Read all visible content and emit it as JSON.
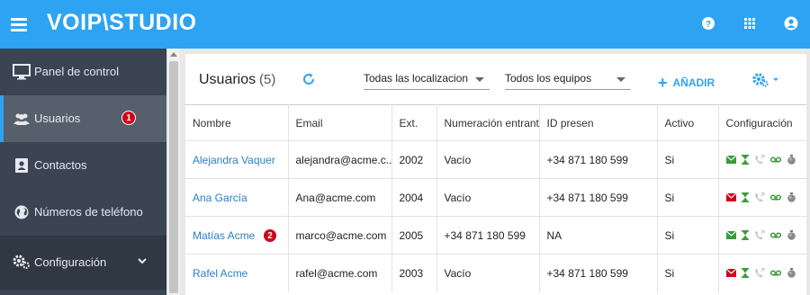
{
  "app": {
    "logo": "VOIP\\STUDIO"
  },
  "sidebar": {
    "items": [
      {
        "label": "Panel de control"
      },
      {
        "label": "Usuarios",
        "badge": "1"
      },
      {
        "label": "Contactos"
      },
      {
        "label": "Números de teléfono"
      },
      {
        "label": "Configuración"
      }
    ]
  },
  "header": {
    "title": "Usuarios",
    "count": "(5)",
    "location_select": "Todas las localizaciones",
    "team_select": "Todos los equipos",
    "add_label": "AÑADIR"
  },
  "table": {
    "columns": [
      "Nombre",
      "Email",
      "Ext.",
      "Numeración entrante",
      "ID presen",
      "Activo",
      "Configuración"
    ],
    "rows": [
      {
        "name": "Alejandra Vaquer",
        "email": "alejandra@acme.c...",
        "ext": "2002",
        "incoming": "Vacío",
        "caller_id": "+34 871 180 599",
        "active": "Si",
        "mail_status": "green"
      },
      {
        "name": "Ana García",
        "email": "Ana@acme.com",
        "ext": "2004",
        "incoming": "Vacío",
        "caller_id": "+34 871 180 599",
        "active": "Si",
        "mail_status": "red"
      },
      {
        "name": "Matías Acme",
        "badge": "2",
        "email": "marco@acme.com",
        "ext": "2005",
        "incoming": "+34 871 180 599",
        "caller_id": "NA",
        "active": "Si",
        "mail_status": "green"
      },
      {
        "name": "Rafel Acme",
        "email": "rafel@acme.com",
        "ext": "2003",
        "incoming": "Vacío",
        "caller_id": "+34 871 180 599",
        "active": "Si",
        "mail_status": "red"
      }
    ]
  },
  "colors": {
    "brand": "#2ea3f2",
    "sidebar": "#3a4452",
    "badge": "#d0021b",
    "ok": "#3a9b3a",
    "error": "#d0021b"
  }
}
